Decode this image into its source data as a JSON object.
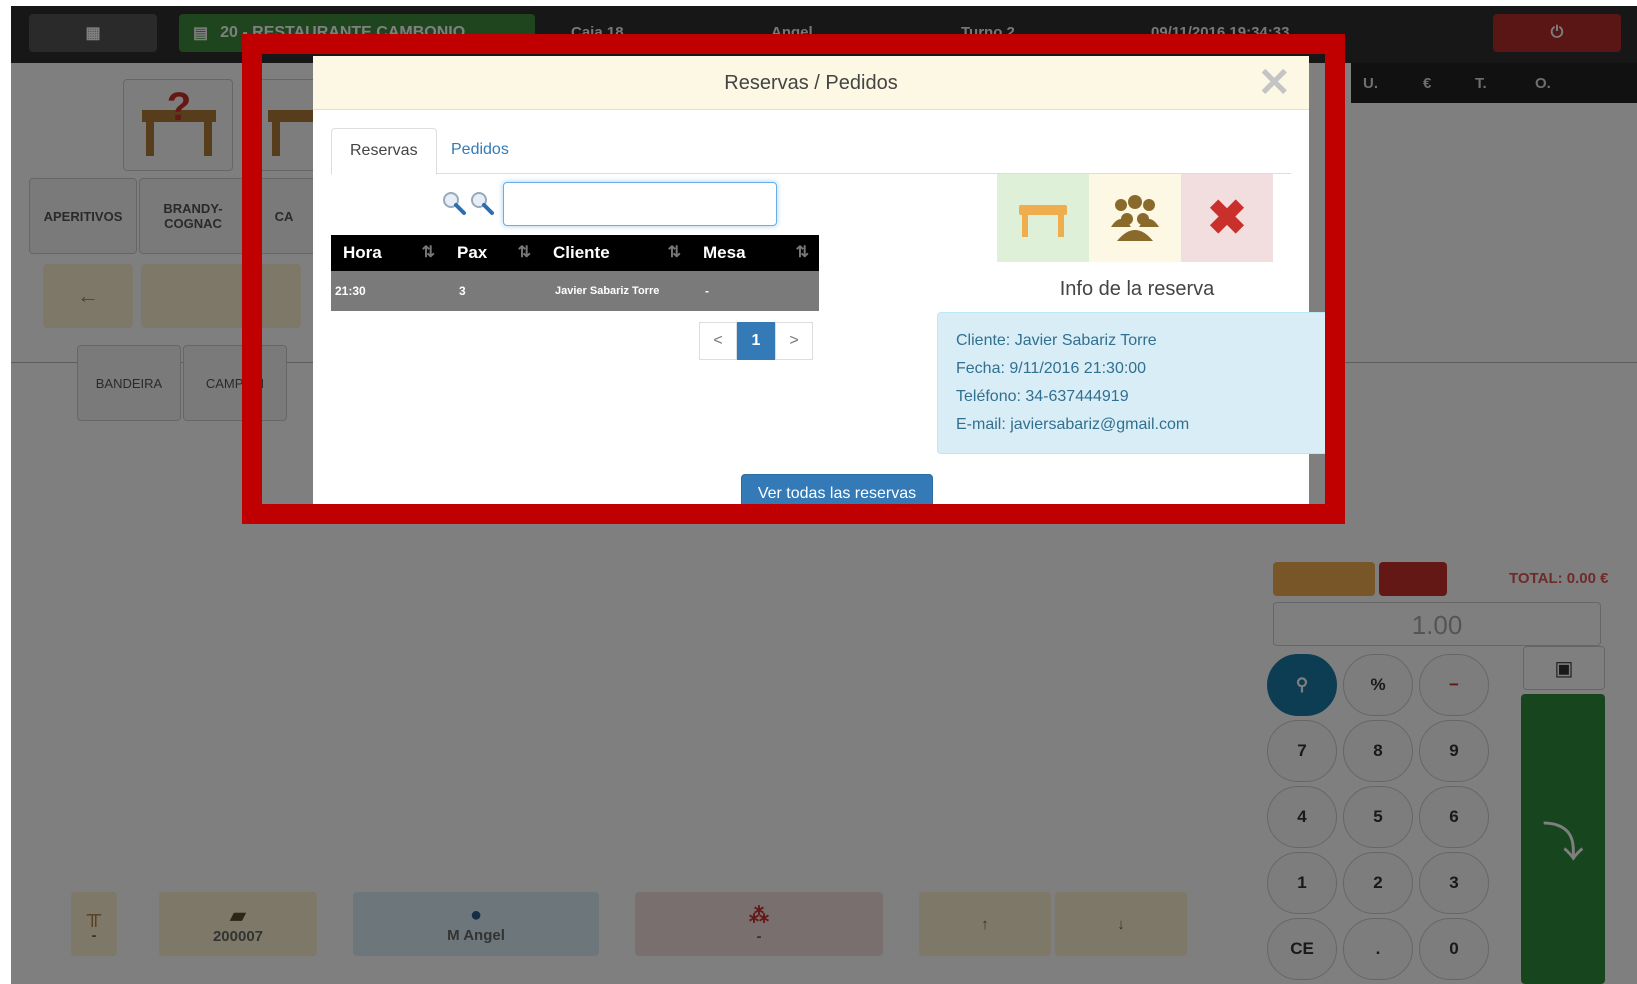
{
  "topbar": {
    "restaurant_label": "20 - RESTAURANTE CAMBONIO",
    "caja_label": "Caja 18",
    "user_label": "Angel",
    "turno_label": "Turno 2",
    "datetime_label": "09/11/2016 19:34:33"
  },
  "column_header": {
    "u": "U.",
    "euro": "€",
    "t": "T.",
    "o": "O."
  },
  "categories": [
    "APERITIVOS",
    "BRANDY-COGNAC",
    "CA"
  ],
  "products": [
    "BANDEIRA",
    "CAMPARI"
  ],
  "right_panel": {
    "total_label": "TOTAL: 0.00 €",
    "quantity_value": "1.00",
    "keys": [
      "%",
      "−",
      "7",
      "8",
      "9",
      "4",
      "5",
      "6",
      "1",
      "2",
      "3",
      "CE",
      ".",
      "0"
    ]
  },
  "bottom_bar": {
    "ticket_number": "200007",
    "waiter_name": "M Angel",
    "table_value": "-",
    "people_value": "-"
  },
  "modal": {
    "title": "Reservas / Pedidos",
    "close_symbol": "✕",
    "tabs": [
      {
        "label": "Reservas",
        "active": true
      },
      {
        "label": "Pedidos",
        "active": false
      }
    ],
    "search_value": "",
    "table": {
      "headers": [
        "Hora",
        "Pax",
        "Cliente",
        "Mesa"
      ],
      "rows": [
        {
          "hora": "21:30",
          "pax": "3",
          "cliente": "Javier Sabariz Torre",
          "mesa": "-"
        }
      ]
    },
    "pagination": {
      "prev": "<",
      "current": "1",
      "next": ">"
    },
    "info_title": "Info de la reserva",
    "info": {
      "cliente": "Cliente: Javier Sabariz Torre",
      "fecha": "Fecha: 9/11/2016 21:30:00",
      "telefono": "Teléfono: 34-637444919",
      "email": "E-mail: javiersabariz@gmail.com"
    },
    "ver_todas_label": "Ver todas las reservas"
  },
  "colors": {
    "highlight_frame": "#c00000",
    "modal_header_bg": "#fcf8e3",
    "primary": "#337ab7",
    "info_bg": "#d9edf7",
    "table_header_bg": "#000000",
    "table_row_bg": "#7a7a7a"
  }
}
